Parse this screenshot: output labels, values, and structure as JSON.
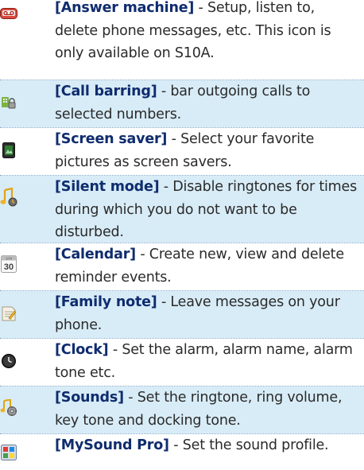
{
  "items": [
    {
      "key": "[Answer machine]",
      "desc": " - Setup, listen to, delete phone messages, etc. This icon is only available on S10A.",
      "icon": "answer-machine-icon"
    },
    {
      "key": "[Call barring]",
      "desc": " - bar outgoing calls to selected numbers.",
      "icon": "call-barring-icon"
    },
    {
      "key": "[Screen saver]",
      "desc": " - Select your favorite pictures as screen savers.",
      "icon": "screen-saver-icon"
    },
    {
      "key": "[Silent mode]",
      "desc": " - Disable ringtones for times during which you do not want to be disturbed.",
      "icon": "silent-mode-icon"
    },
    {
      "key": "[Calendar]",
      "desc": " - Create new, view and delete reminder events.",
      "icon": "calendar-icon",
      "icon_text_top": "JAN",
      "icon_text_num": "30"
    },
    {
      "key": "[Family note]",
      "desc": " - Leave messages on your phone.",
      "icon": "family-note-icon"
    },
    {
      "key": "[Clock]",
      "desc": " - Set the alarm, alarm name, alarm tone etc.",
      "icon": "clock-icon"
    },
    {
      "key": "[Sounds]",
      "desc": " - Set the ringtone, ring volume, key tone and docking tone.",
      "icon": "sounds-icon"
    },
    {
      "key": "[MySound Pro]",
      "desc": " - Set the sound profile.",
      "icon": "mysound-pro-icon"
    }
  ],
  "colors": {
    "key_text": "#0f2c6e",
    "body_text": "#2a2a2a",
    "shade": "#d8ecf7",
    "separator": "#7da6c8"
  }
}
